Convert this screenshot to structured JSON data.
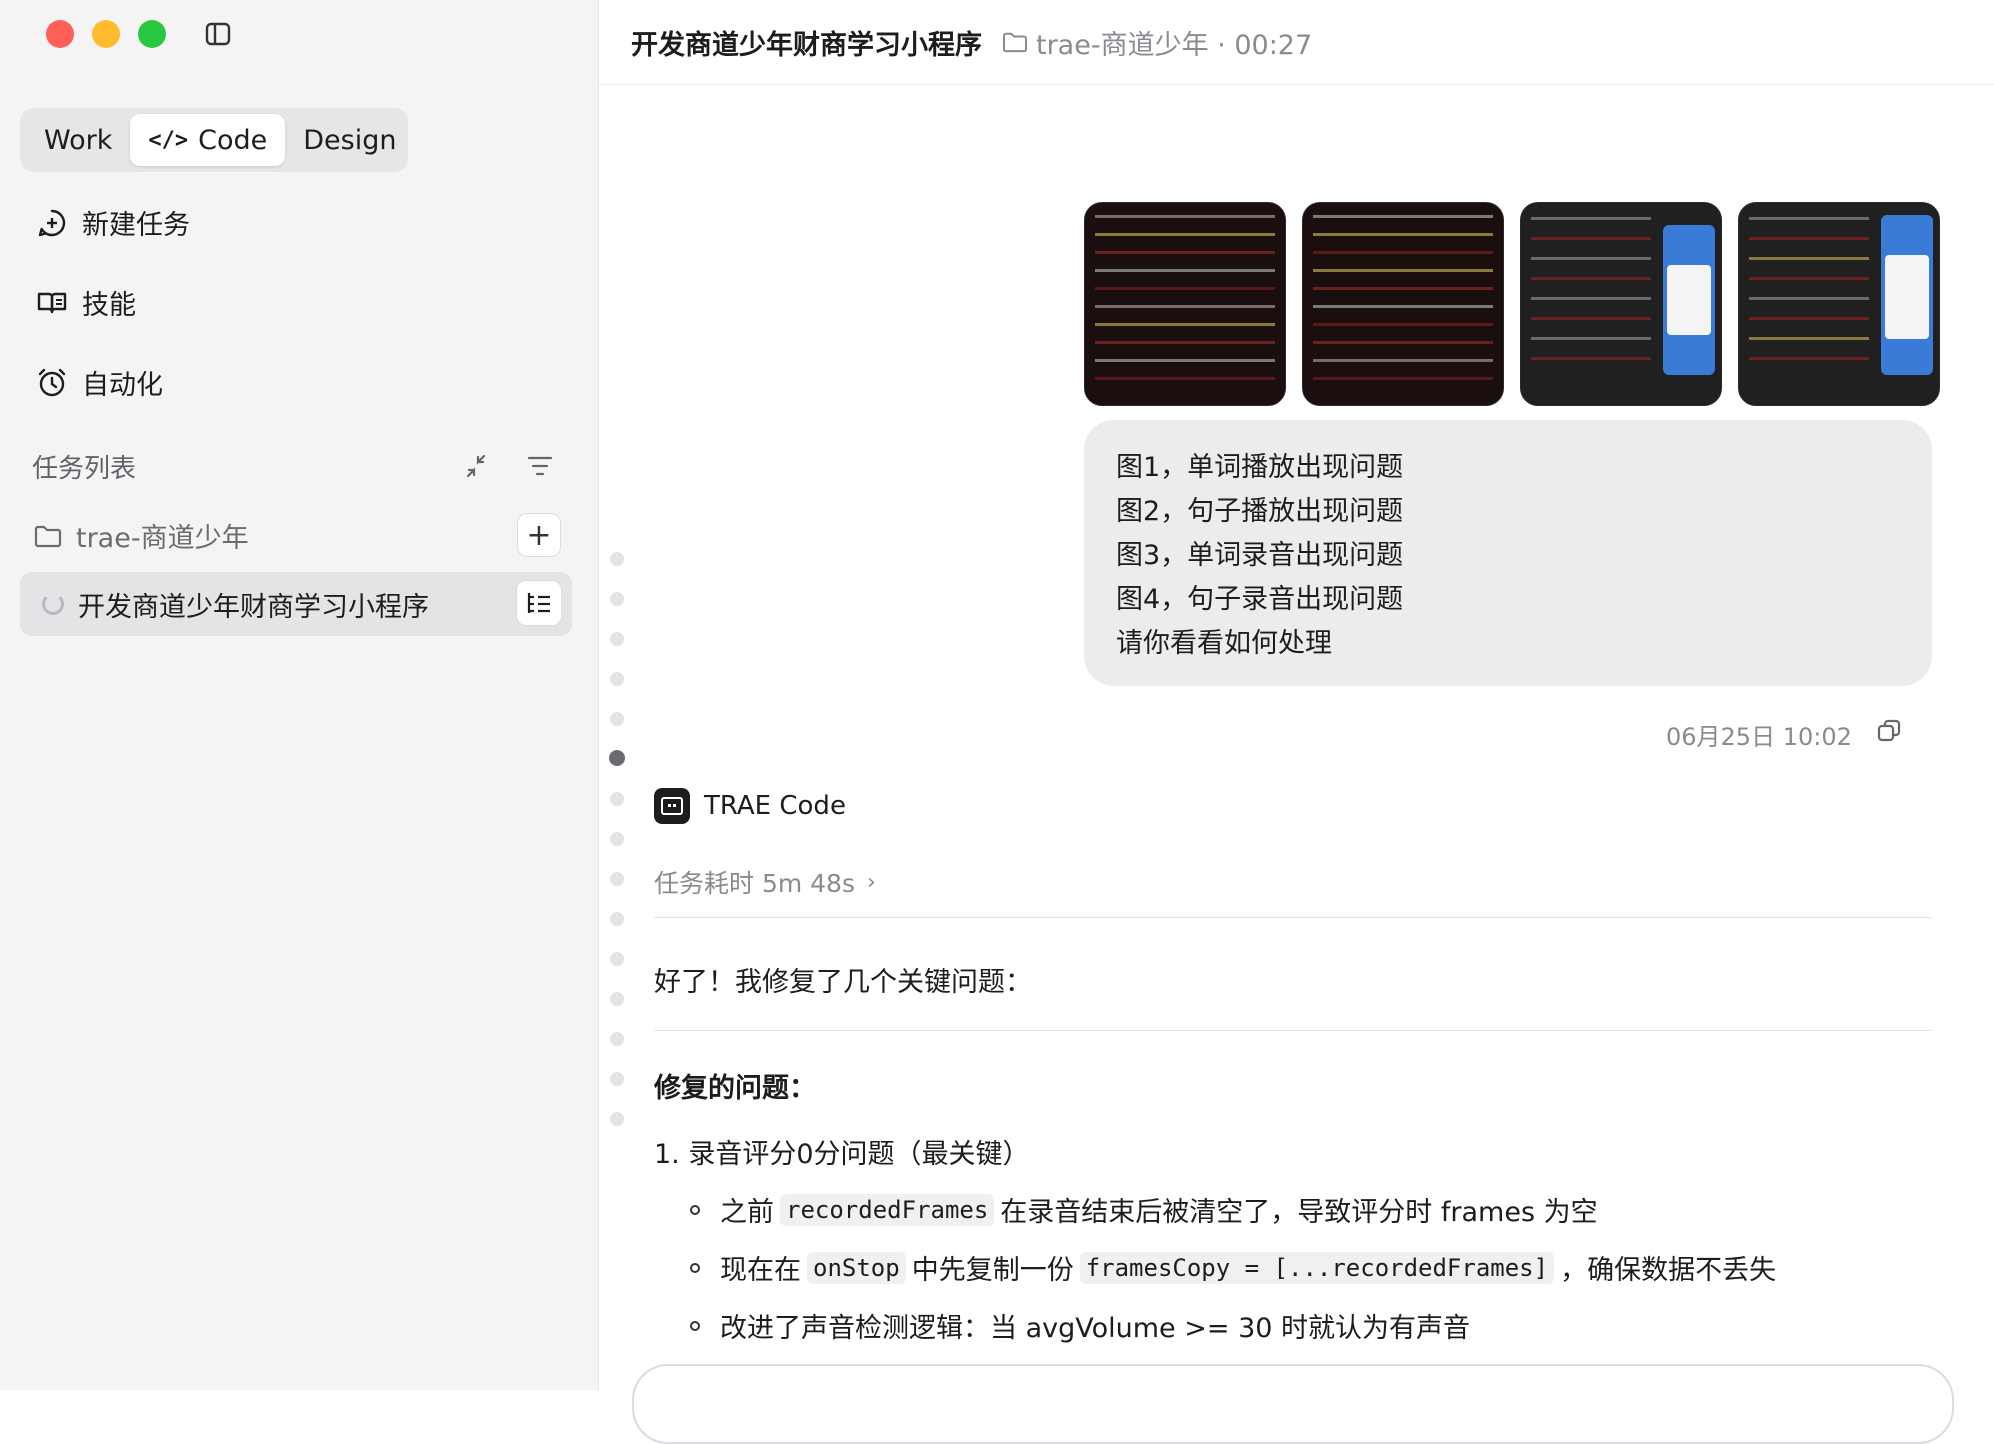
{
  "sidebar": {
    "modes": [
      "Work",
      "Code",
      "Design"
    ],
    "active_mode": "Code",
    "nav": {
      "new_task": "新建任务",
      "skills": "技能",
      "automation": "自动化"
    },
    "task_list_title": "任务列表",
    "project_folder": "trae-商道少年",
    "add_label": "+",
    "tasks": [
      {
        "label": "开发商道少年财商学习小程序",
        "status": "running"
      }
    ]
  },
  "header": {
    "title": "开发商道少年财商学习小程序",
    "meta": "trae-商道少年 · 00:27"
  },
  "conversation": {
    "user_message": {
      "attachments": [
        "screenshot-1",
        "screenshot-2",
        "screenshot-3",
        "screenshot-4"
      ],
      "lines": [
        "图1，单词播放出现问题",
        "图2，句子播放出现问题",
        "图3，单词录音出现问题",
        "图4，句子录音出现问题",
        "请你看看如何处理"
      ],
      "timestamp": "06月25日 10:02"
    },
    "agent": {
      "name": "TRAE Code",
      "duration": "任务耗时 5m 48s",
      "intro": "好了！我修复了几个关键问题：",
      "section_title": "修复的问题：",
      "item_1_title": "1. 录音评分0分问题（最关键）",
      "bullets": [
        {
          "before": "之前",
          "code": "recordedFrames",
          "after": "在录音结束后被清空了，导致评分时 frames 为空"
        },
        {
          "before": "现在在",
          "code": "onStop",
          "middle": "中先复制一份",
          "code2": "framesCopy = [...recordedFrames]",
          "after": "，确保数据不丢失"
        },
        {
          "before": "改进了声音检测逻辑：当 avgVolume >= 30 时就认为有声音"
        }
      ]
    }
  },
  "colors": {
    "traffic_red": "#ff5f57",
    "traffic_yellow": "#febc2e",
    "traffic_green": "#28c840",
    "sidebar_bg": "#f4f4f5",
    "bubble_bg": "#ececee"
  },
  "icons": [
    "sidebar-toggle-icon",
    "new-task-icon",
    "skills-icon",
    "automation-icon",
    "collapse-icon",
    "filter-icon",
    "folder-icon",
    "plus-icon",
    "spinner-icon",
    "task-list-icon",
    "copy-icon",
    "agent-icon",
    "chevron-right-icon"
  ]
}
